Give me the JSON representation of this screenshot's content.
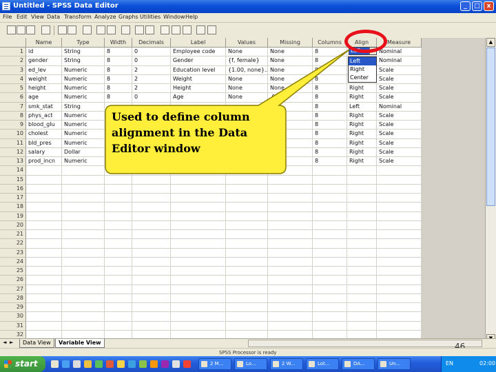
{
  "window": {
    "title": "Untitled - SPSS Data Editor",
    "controls": [
      "_",
      "□",
      "x"
    ]
  },
  "menu": [
    "File",
    "Edit",
    "View",
    "Data",
    "Transform",
    "Analyze",
    "Graphs",
    "Utilities",
    "Window",
    "Help"
  ],
  "toolbar": {
    "icons": [
      "open-icon",
      "save-icon",
      "print-icon",
      "dialog-recall-icon",
      "undo-icon",
      "redo-icon",
      "goto-chart-icon",
      "goto-case-icon",
      "variables-icon",
      "find-icon",
      "insert-case-icon",
      "insert-variable-icon",
      "split-file-icon",
      "weight-cases-icon",
      "select-cases-icon",
      "value-labels-icon",
      "use-sets-icon"
    ]
  },
  "grid": {
    "columns": [
      "Name",
      "Type",
      "Width",
      "Decimals",
      "Label",
      "Values",
      "Missing",
      "Columns",
      "Align",
      "Measure"
    ],
    "rows": [
      [
        "id",
        "String",
        "8",
        "0",
        "Employee code",
        "None",
        "None",
        "8",
        "Left",
        "Nominal"
      ],
      [
        "gender",
        "String",
        "8",
        "0",
        "Gender",
        "{f, female}",
        "None",
        "8",
        "Left",
        "Nominal"
      ],
      [
        "ed_lev",
        "Numeric",
        "8",
        "2",
        "Education level",
        "{1.00, none}...",
        "None",
        "8",
        "Right",
        "Scale"
      ],
      [
        "weight",
        "Numeric",
        "8",
        "2",
        "Weight",
        "None",
        "None",
        "8",
        "Right",
        "Scale"
      ],
      [
        "height",
        "Numeric",
        "8",
        "2",
        "Height",
        "None",
        "None",
        "8",
        "Right",
        "Scale"
      ],
      [
        "age",
        "Numeric",
        "8",
        "0",
        "Age",
        "None",
        ".00",
        "8",
        "Right",
        "Scale"
      ],
      [
        "smk_stat",
        "String",
        "",
        "",
        "",
        "",
        "",
        "8",
        "Left",
        "Nominal"
      ],
      [
        "phys_act",
        "Numeric",
        "",
        "",
        "",
        "",
        "",
        "8",
        "Right",
        "Scale"
      ],
      [
        "blood_glu",
        "Numeric",
        "",
        "",
        "",
        "",
        "",
        "8",
        "Right",
        "Scale"
      ],
      [
        "cholest",
        "Numeric",
        "",
        "",
        "",
        "",
        "",
        "8",
        "Right",
        "Scale"
      ],
      [
        "bld_pres",
        "Numeric",
        "",
        "",
        "",
        "",
        "",
        "8",
        "Right",
        "Scale"
      ],
      [
        "salary",
        "Dollar",
        "",
        "",
        "",
        "",
        "",
        "8",
        "Right",
        "Scale"
      ],
      [
        "prod_incn",
        "Numeric",
        "",
        "",
        "",
        "",
        "",
        "8",
        "Right",
        "Scale"
      ]
    ],
    "row_numbers": [
      "1",
      "2",
      "3",
      "4",
      "5",
      "6",
      "7",
      "8",
      "9",
      "10",
      "11",
      "12",
      "13",
      "14",
      "15",
      "16",
      "17",
      "18",
      "19",
      "20",
      "21",
      "22",
      "23",
      "24",
      "25",
      "26",
      "27",
      "28",
      "29",
      "30",
      "31",
      "32"
    ]
  },
  "align_dropdown": {
    "selected": "Left",
    "options": [
      "Left",
      "Right",
      "Center"
    ],
    "highlighted": "Left"
  },
  "callout": {
    "text": "Used to define column alignment in the Data Editor window"
  },
  "tabs": {
    "data_view": "Data View",
    "variable_view": "Variable View"
  },
  "status": {
    "text": "SPSS Processor is ready"
  },
  "slide_number": "46",
  "taskbar": {
    "start": "start",
    "tasks": [
      "2 M...",
      "Lo...",
      "2 W...",
      "Lot...",
      "DA...",
      "Un..."
    ],
    "lang": "EN",
    "clock": "02:00"
  },
  "colors": {
    "callout_fill": "#ffee3a",
    "callout_border": "#8a7d00",
    "highlight_ellipse": "#e8101a",
    "selection": "#2858c8"
  }
}
